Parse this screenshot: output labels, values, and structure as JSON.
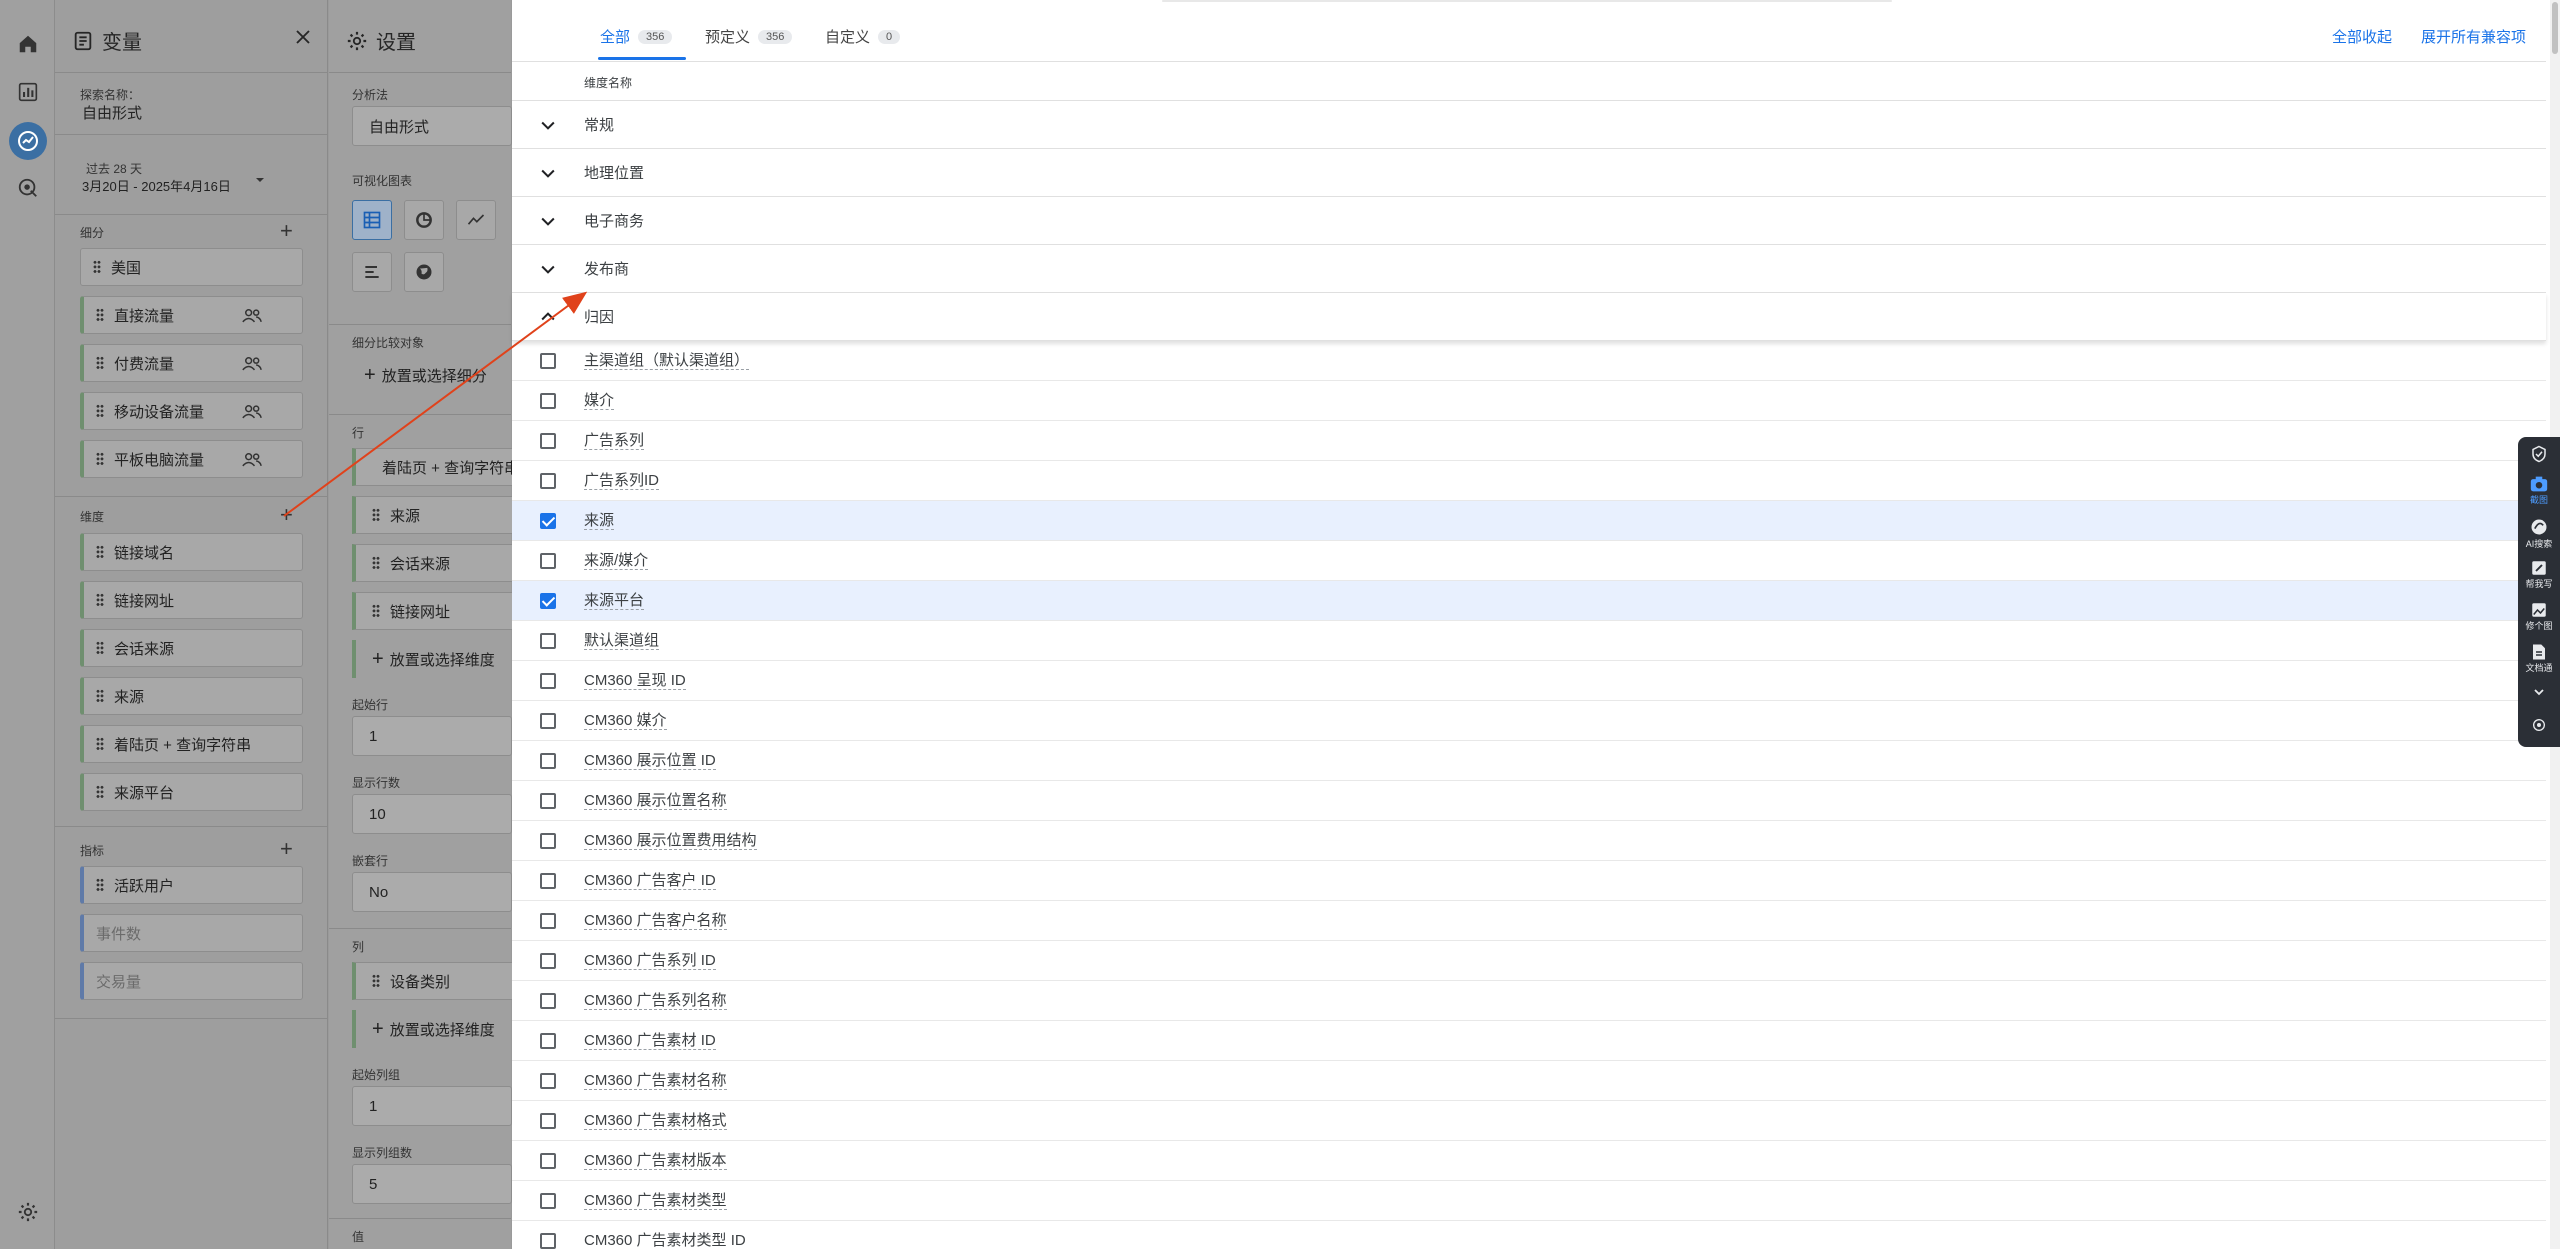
{
  "rail": {
    "icons": [
      "home-icon",
      "reports-icon",
      "explore-icon",
      "advertising-icon",
      "settings-icon"
    ]
  },
  "variables": {
    "title": "变量",
    "exploration_name_label": "探索名称：",
    "exploration_name": "自由形式",
    "date_label": "过去 28 天",
    "date_range": "3月20日 - 2025年4月16日",
    "segments_label": "细分",
    "segments": [
      {
        "label": "美国",
        "people": false
      },
      {
        "label": "直接流量",
        "people": true
      },
      {
        "label": "付费流量",
        "people": true
      },
      {
        "label": "移动设备流量",
        "people": true
      },
      {
        "label": "平板电脑流量",
        "people": true
      }
    ],
    "dimensions_label": "维度",
    "dimensions": [
      "链接域名",
      "链接网址",
      "会话来源",
      "来源",
      "着陆页 + 查询字符串",
      "来源平台"
    ],
    "metrics_label": "指标",
    "metrics": [
      "活跃用户",
      "事件数",
      "交易量"
    ]
  },
  "settings": {
    "title": "设置",
    "technique_label": "分析法",
    "technique_value": "自由形式",
    "viz_label": "可视化图表",
    "segment_compare_label": "细分比较对象",
    "segment_compare_drop": "放置或选择细分",
    "rows_label": "行",
    "rows": [
      "着陆页 + 查询字符串",
      "来源",
      "会话来源",
      "链接网址"
    ],
    "rows_drop": "放置或选择维度",
    "start_row_label": "起始行",
    "start_row": "1",
    "show_rows_label": "显示行数",
    "show_rows": "10",
    "nested_rows_label": "嵌套行",
    "nested_rows": "No",
    "columns_label": "列",
    "columns": [
      "设备类别"
    ],
    "columns_drop": "放置或选择维度",
    "start_col_label": "起始列组",
    "start_col": "1",
    "show_cols_label": "显示列组数",
    "show_cols": "5",
    "values_label": "值"
  },
  "sheet": {
    "tabs": [
      {
        "label": "全部",
        "count": "356",
        "active": true
      },
      {
        "label": "预定义",
        "count": "356",
        "active": false
      },
      {
        "label": "自定义",
        "count": "0",
        "active": false
      }
    ],
    "collapse_all": "全部收起",
    "expand_all": "展开所有兼容项",
    "column_header": "维度名称",
    "groups": [
      {
        "label": "常规",
        "open": false
      },
      {
        "label": "地理位置",
        "open": false
      },
      {
        "label": "电子商务",
        "open": false
      },
      {
        "label": "发布商",
        "open": false
      },
      {
        "label": "归因",
        "open": true
      }
    ],
    "rows": [
      {
        "label": "主渠道组（默认渠道组）",
        "checked": false
      },
      {
        "label": "媒介",
        "checked": false
      },
      {
        "label": "广告系列",
        "checked": false
      },
      {
        "label": "广告系列ID",
        "checked": false
      },
      {
        "label": "来源",
        "checked": true
      },
      {
        "label": "来源/媒介",
        "checked": false
      },
      {
        "label": "来源平台",
        "checked": true
      },
      {
        "label": "默认渠道组",
        "checked": false
      },
      {
        "label": "CM360 呈现 ID",
        "checked": false
      },
      {
        "label": "CM360 媒介",
        "checked": false
      },
      {
        "label": "CM360 展示位置 ID",
        "checked": false
      },
      {
        "label": "CM360 展示位置名称",
        "checked": false
      },
      {
        "label": "CM360 展示位置费用结构",
        "checked": false
      },
      {
        "label": "CM360 广告客户 ID",
        "checked": false
      },
      {
        "label": "CM360 广告客户名称",
        "checked": false
      },
      {
        "label": "CM360 广告系列 ID",
        "checked": false
      },
      {
        "label": "CM360 广告系列名称",
        "checked": false
      },
      {
        "label": "CM360 广告素材 ID",
        "checked": false
      },
      {
        "label": "CM360 广告素材名称",
        "checked": false
      },
      {
        "label": "CM360 广告素材格式",
        "checked": false
      },
      {
        "label": "CM360 广告素材版本",
        "checked": false
      },
      {
        "label": "CM360 广告素材类型",
        "checked": false
      },
      {
        "label": "CM360 广告素材类型 ID",
        "checked": false
      }
    ]
  },
  "floatbar": {
    "items": [
      {
        "label": "",
        "icon": "shield-icon"
      },
      {
        "label": "截图",
        "icon": "screenshot-icon",
        "active": true
      },
      {
        "label": "AI搜索",
        "icon": "ai-search-icon"
      },
      {
        "label": "帮我写",
        "icon": "write-icon"
      },
      {
        "label": "修个图",
        "icon": "image-edit-icon"
      },
      {
        "label": "文档通",
        "icon": "document-icon"
      }
    ]
  }
}
